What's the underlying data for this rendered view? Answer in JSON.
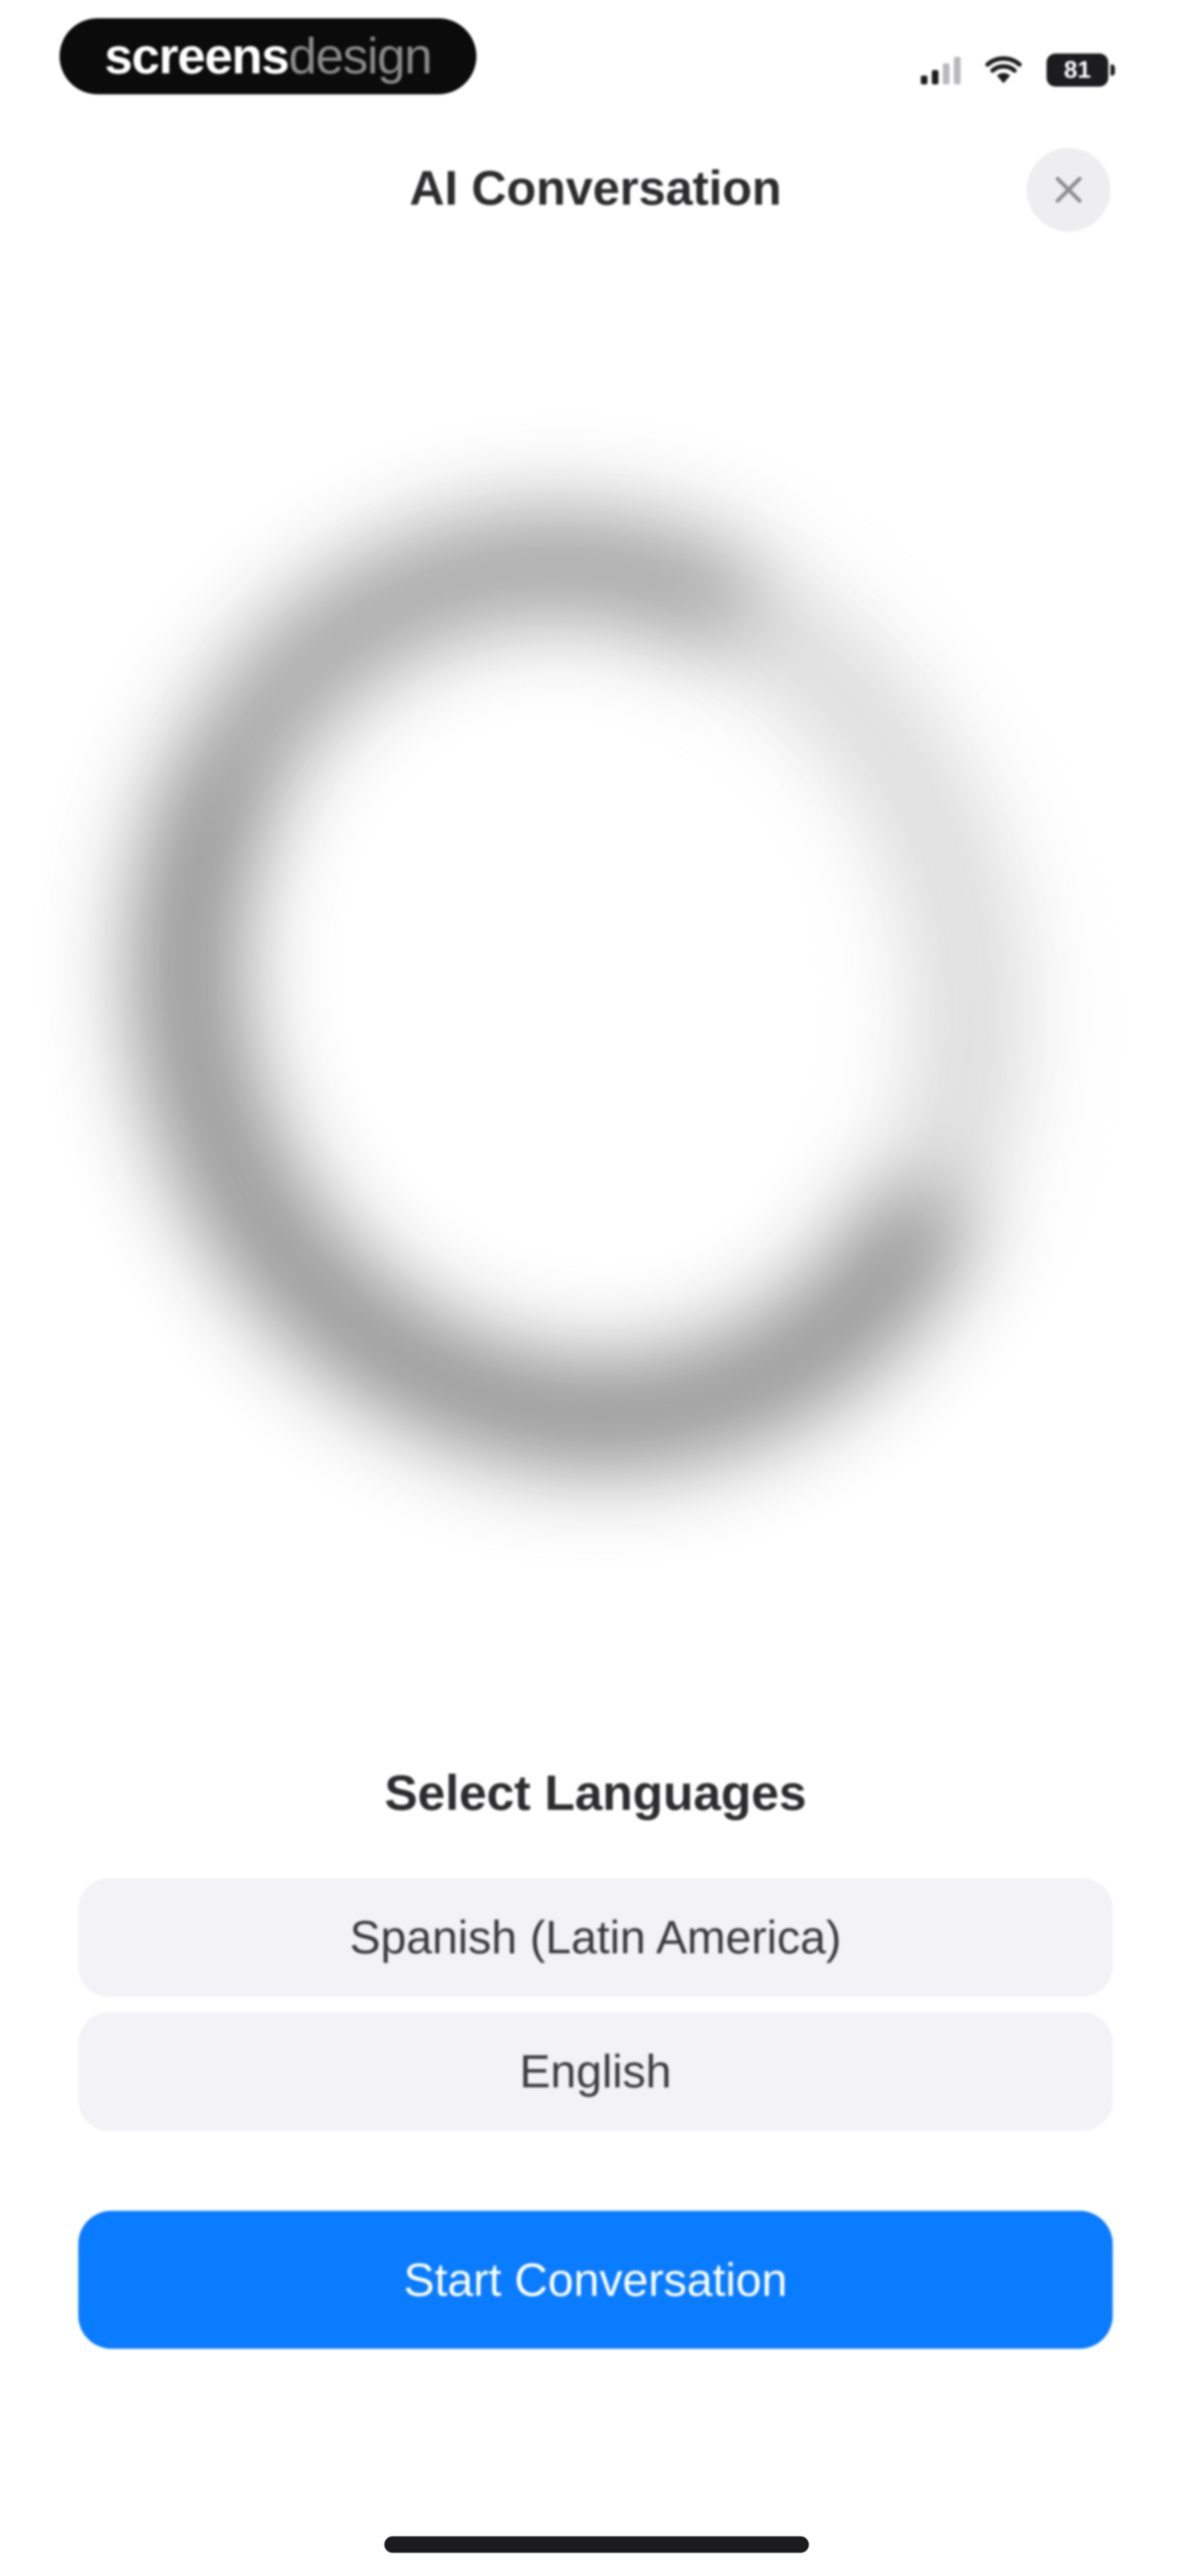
{
  "watermark": {
    "part_bold": "screens",
    "part_light": "design"
  },
  "status_bar": {
    "battery_level": "81",
    "icons": [
      "cellular-signal-icon",
      "wifi-icon",
      "battery-icon"
    ]
  },
  "header": {
    "title": "AI Conversation",
    "close_icon": "close-icon"
  },
  "languages": {
    "title": "Select Languages",
    "options": [
      {
        "label": "Spanish (Latin America)"
      },
      {
        "label": "English"
      }
    ]
  },
  "actions": {
    "start_label": "Start Conversation"
  },
  "colors": {
    "accent": "#0a7cff",
    "option_background": "#f2f2f7",
    "close_background": "#eeeef0"
  }
}
